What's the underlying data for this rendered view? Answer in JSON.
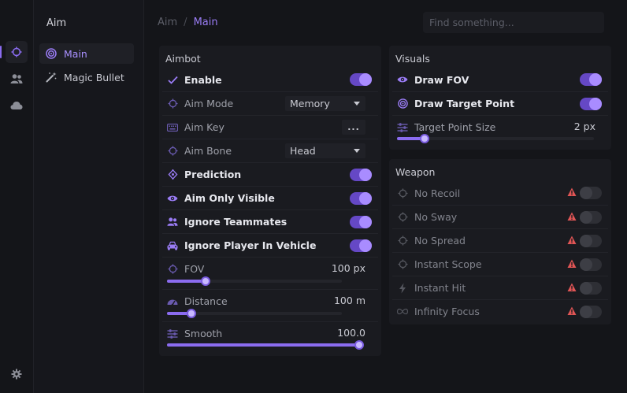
{
  "rail": {
    "items": [
      {
        "icon": "crosshair-icon",
        "active": true
      },
      {
        "icon": "users-icon",
        "active": false
      },
      {
        "icon": "cloud-icon",
        "active": false
      }
    ],
    "settings_icon": "gear-icon"
  },
  "sidebar": {
    "title": "Aim",
    "items": [
      {
        "label": "Main",
        "icon": "target-icon",
        "active": true
      },
      {
        "label": "Magic Bullet",
        "icon": "magic-wand-icon",
        "active": false
      }
    ]
  },
  "breadcrumb": {
    "parent": "Aim",
    "separator": "/",
    "current": "Main"
  },
  "search": {
    "placeholder": "Find something..."
  },
  "aimbot": {
    "title": "Aimbot",
    "enable": {
      "label": "Enable",
      "on": true
    },
    "aim_mode": {
      "label": "Aim Mode",
      "value": "Memory"
    },
    "aim_key": {
      "label": "Aim Key",
      "value": "..."
    },
    "aim_bone": {
      "label": "Aim Bone",
      "value": "Head"
    },
    "prediction": {
      "label": "Prediction",
      "on": true
    },
    "aim_only_visible": {
      "label": "Aim Only Visible",
      "on": true
    },
    "ignore_teammates": {
      "label": "Ignore Teammates",
      "on": true
    },
    "ignore_vehicle": {
      "label": "Ignore Player In Vehicle",
      "on": true
    },
    "fov": {
      "label": "FOV",
      "value": "100 px",
      "fraction": 0.22
    },
    "distance": {
      "label": "Distance",
      "value": "100 m",
      "fraction": 0.14
    },
    "smooth": {
      "label": "Smooth",
      "value": "100.0",
      "fraction": 1.0
    }
  },
  "visuals": {
    "title": "Visuals",
    "draw_fov": {
      "label": "Draw FOV",
      "on": true
    },
    "draw_target_point": {
      "label": "Draw Target Point",
      "on": true
    },
    "target_point_size": {
      "label": "Target Point Size",
      "value": "2 px",
      "fraction": 0.14
    }
  },
  "weapon": {
    "title": "Weapon",
    "items": [
      {
        "label": "No Recoil",
        "icon": "crosshair-icon",
        "on": false
      },
      {
        "label": "No Sway",
        "icon": "crosshair-icon",
        "on": false
      },
      {
        "label": "No Spread",
        "icon": "crosshair-icon",
        "on": false
      },
      {
        "label": "Instant Scope",
        "icon": "crosshair-icon",
        "on": false
      },
      {
        "label": "Instant Hit",
        "icon": "lightning-icon",
        "on": false
      },
      {
        "label": "Infinity Focus",
        "icon": "infinity-icon",
        "on": false
      }
    ]
  },
  "colors": {
    "accent": "#8b6cf0",
    "warning": "#e05555",
    "background": "#141519",
    "panel": "#1a1b20"
  }
}
